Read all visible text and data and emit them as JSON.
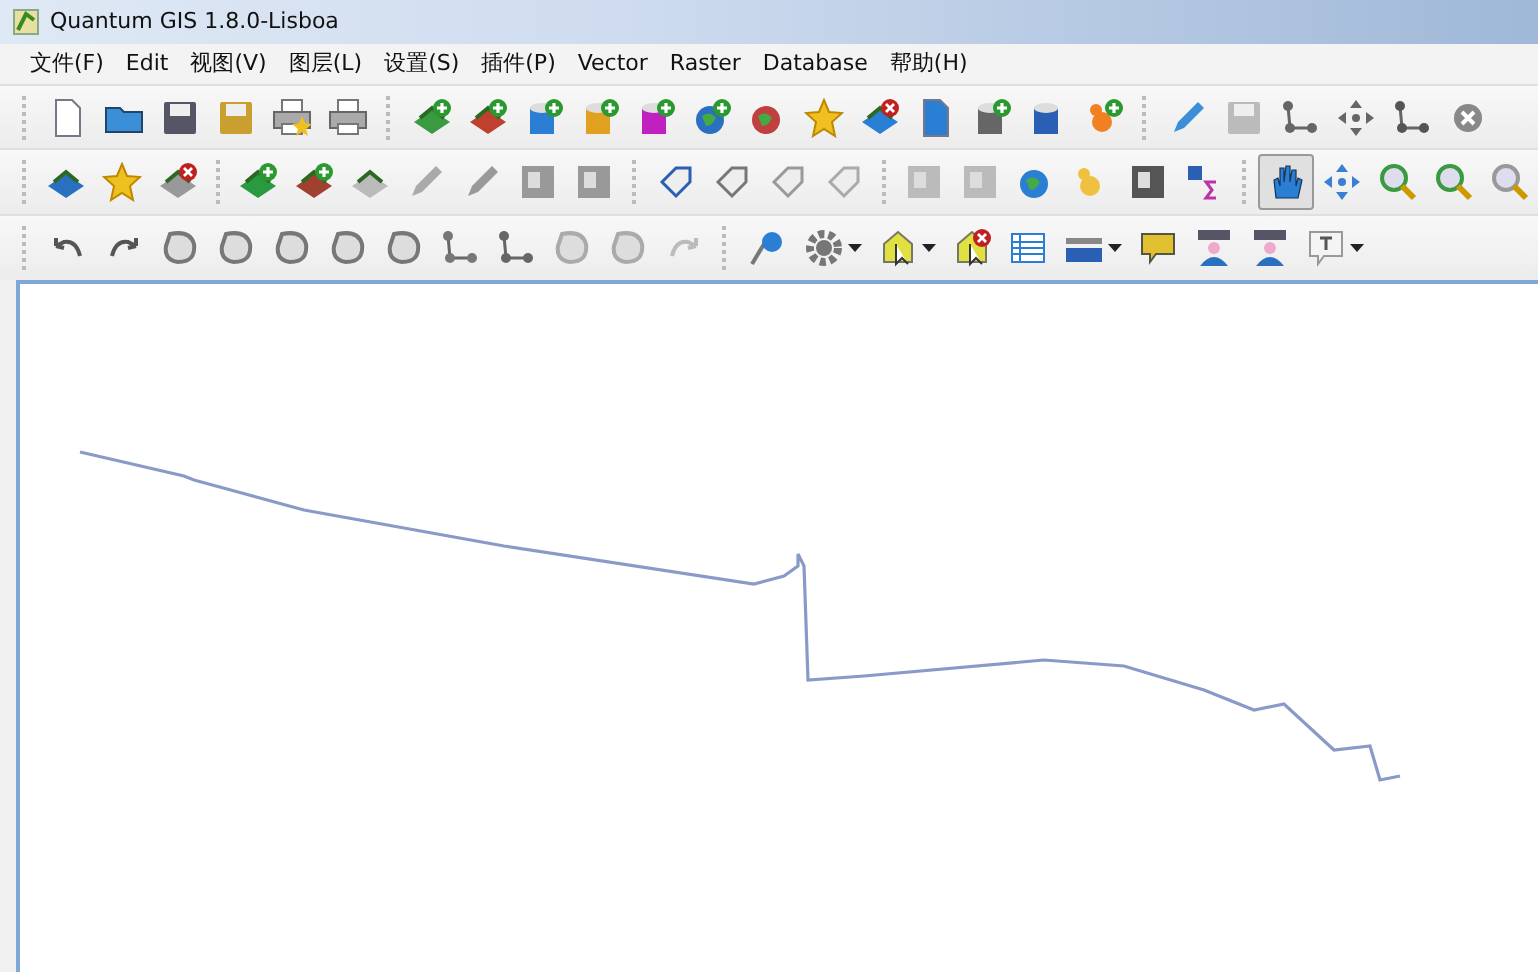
{
  "window": {
    "title": "Quantum GIS 1.8.0-Lisboa"
  },
  "menu": [
    "文件(F)",
    "Edit",
    "视图(V)",
    "图层(L)",
    "设置(S)",
    "插件(P)",
    "Vector",
    "Raster",
    "Database",
    "帮助(H)"
  ],
  "toolbars": [
    {
      "groups": [
        [
          {
            "selected": false
          },
          {
            "selected": false
          },
          {
            "selected": false
          },
          {
            "selected": false
          },
          {
            "selected": false
          },
          {
            "selected": false
          }
        ],
        [
          {
            "selected": false
          },
          {
            "selected": false
          },
          {
            "selected": false
          },
          {
            "selected": false
          },
          {
            "selected": false
          },
          {
            "selected": false
          },
          {
            "selected": false
          },
          {
            "selected": false
          },
          {
            "selected": false
          },
          {
            "selected": false
          },
          {
            "selected": false
          },
          {
            "selected": false
          },
          {
            "selected": false
          }
        ],
        [
          {
            "selected": false
          },
          {
            "selected": false
          },
          {
            "selected": false
          },
          {
            "selected": false
          },
          {
            "selected": false
          },
          {
            "selected": false
          }
        ]
      ]
    },
    {
      "groups": [
        [
          {
            "selected": false
          },
          {
            "selected": false
          },
          {
            "selected": false
          }
        ],
        [
          {
            "selected": false
          },
          {
            "selected": false
          },
          {
            "selected": false
          },
          {
            "selected": false
          },
          {
            "selected": false
          },
          {
            "selected": false
          },
          {
            "selected": false
          }
        ],
        [
          {
            "selected": false
          },
          {
            "selected": false
          },
          {
            "selected": false
          },
          {
            "selected": false
          }
        ],
        [
          {
            "selected": false
          },
          {
            "selected": false
          },
          {
            "selected": false
          },
          {
            "selected": false
          },
          {
            "selected": false
          },
          {
            "selected": false
          }
        ],
        [
          {
            "selected": true
          },
          {
            "selected": false
          },
          {
            "selected": false
          },
          {
            "selected": false
          },
          {
            "selected": false
          }
        ]
      ]
    },
    {
      "groups": [
        [
          {
            "selected": false
          },
          {
            "selected": false
          },
          {
            "selected": false
          },
          {
            "selected": false
          },
          {
            "selected": false
          },
          {
            "selected": false
          },
          {
            "selected": false
          },
          {
            "selected": false
          },
          {
            "selected": false
          },
          {
            "selected": false
          },
          {
            "selected": false
          },
          {
            "selected": false
          }
        ],
        [
          {
            "selected": false
          },
          {
            "selected": false
          },
          {
            "selected": false
          },
          {
            "selected": false
          },
          {
            "selected": false
          },
          {
            "selected": false
          },
          {
            "selected": false
          },
          {
            "selected": false
          },
          {
            "selected": false
          },
          {
            "selected": false
          }
        ]
      ]
    }
  ]
}
